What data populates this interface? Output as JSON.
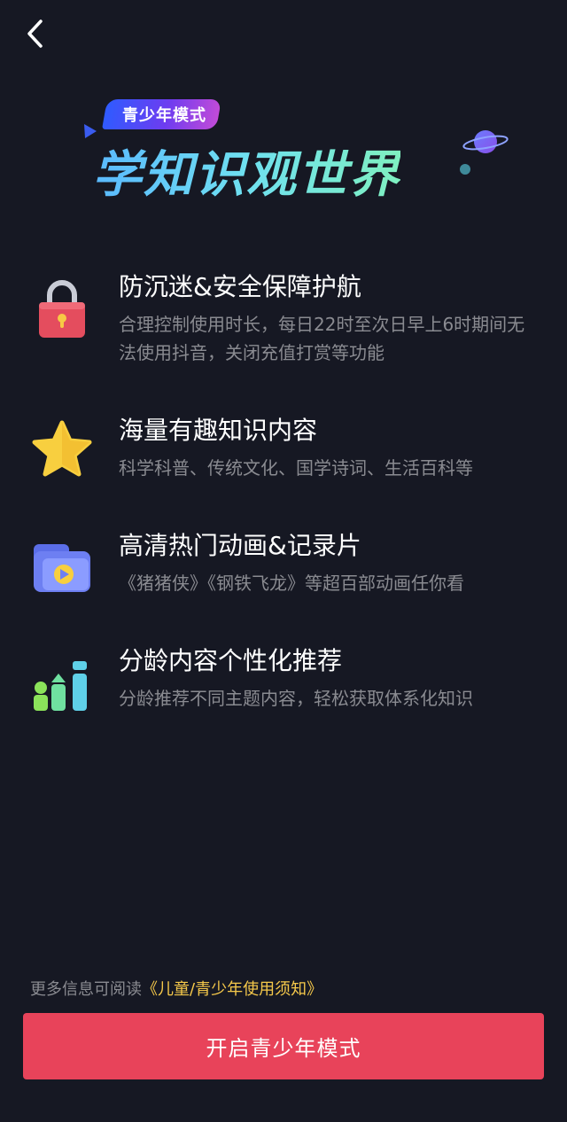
{
  "nav": {
    "back_icon": "chevron-left-icon"
  },
  "hero": {
    "badge": "青少年模式",
    "title": "学知识观世界"
  },
  "features": [
    {
      "icon": "lock-icon",
      "title": "防沉迷&安全保障护航",
      "desc": "合理控制使用时长，每日22时至次日早上6时期间无法使用抖音，关闭充值打赏等功能"
    },
    {
      "icon": "star-icon",
      "title": "海量有趣知识内容",
      "desc": "科学科普、传统文化、国学诗词、生活百科等"
    },
    {
      "icon": "video-folder-icon",
      "title": "高清热门动画&记录片",
      "desc": "《猪猪侠》《钢铁飞龙》等超百部动画任你看"
    },
    {
      "icon": "age-chart-icon",
      "title": "分龄内容个性化推荐",
      "desc": "分龄推荐不同主题内容，轻松获取体系化知识"
    }
  ],
  "footer": {
    "note_prefix": "更多信息可阅读",
    "note_link": "《儿童/青少年使用须知》"
  },
  "primary_button": {
    "label": "开启青少年模式"
  },
  "colors": {
    "background": "#161823",
    "button": "#e8435a",
    "link": "#f5c84a",
    "secondary_text": "#8a8b91"
  }
}
